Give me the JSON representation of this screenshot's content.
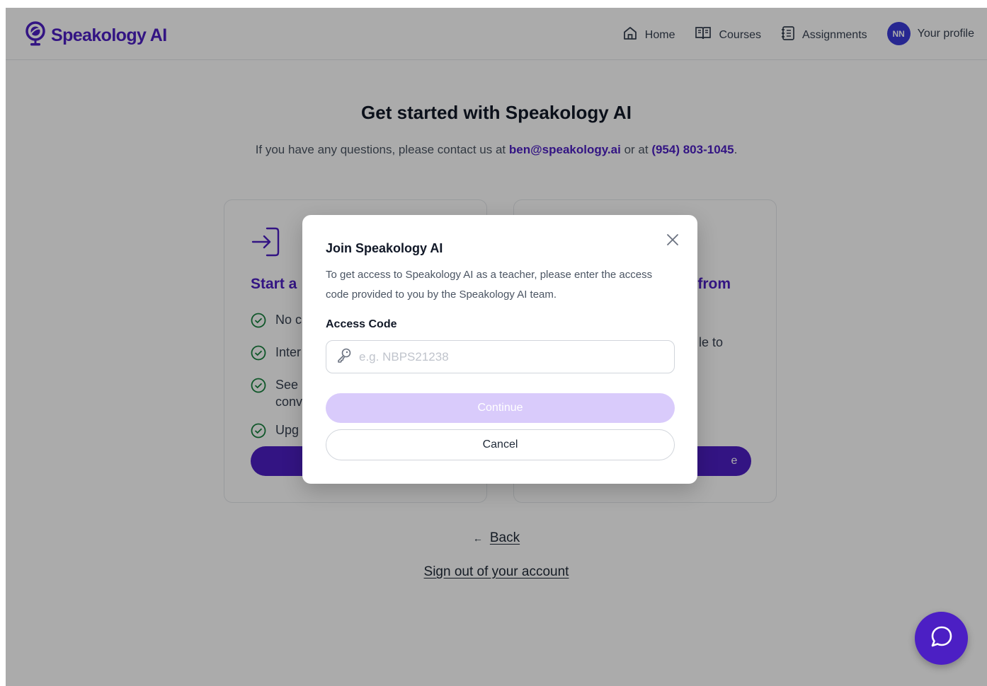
{
  "app": {
    "brand": "Speakology AI",
    "accent_color": "#4c1fc4"
  },
  "nav": {
    "items": [
      {
        "label": "Home",
        "icon": "home-icon"
      },
      {
        "label": "Courses",
        "icon": "book-open-icon"
      },
      {
        "label": "Assignments",
        "icon": "notebook-icon"
      }
    ],
    "profile": {
      "initials": "NN",
      "label": "Your profile"
    }
  },
  "page": {
    "title": "Get started with Speakology AI",
    "subtitle_prefix": "If you have any questions, please contact us at ",
    "email": "ben@speakology.ai",
    "subtitle_mid": " or at ",
    "phone": "(954) 803-1045",
    "subtitle_suffix": "."
  },
  "cards": {
    "left": {
      "title": "Start a",
      "features": [
        "No c",
        "Inter",
        "See",
        "Upg"
      ],
      "feature_continuation": "conv"
    },
    "right": {
      "title": "from",
      "text": "le to",
      "button_label": "e"
    }
  },
  "footer": {
    "back_arrow": "←",
    "back_label": "Back",
    "signout_label": "Sign out of your account"
  },
  "modal": {
    "title": "Join Speakology AI",
    "description": "To get access to Speakology AI as a teacher, please enter the access code provided to you by the Speakology AI team.",
    "field_label": "Access Code",
    "field_value": "",
    "field_placeholder": "e.g. NBPS21238",
    "continue_label": "Continue",
    "cancel_label": "Cancel"
  }
}
